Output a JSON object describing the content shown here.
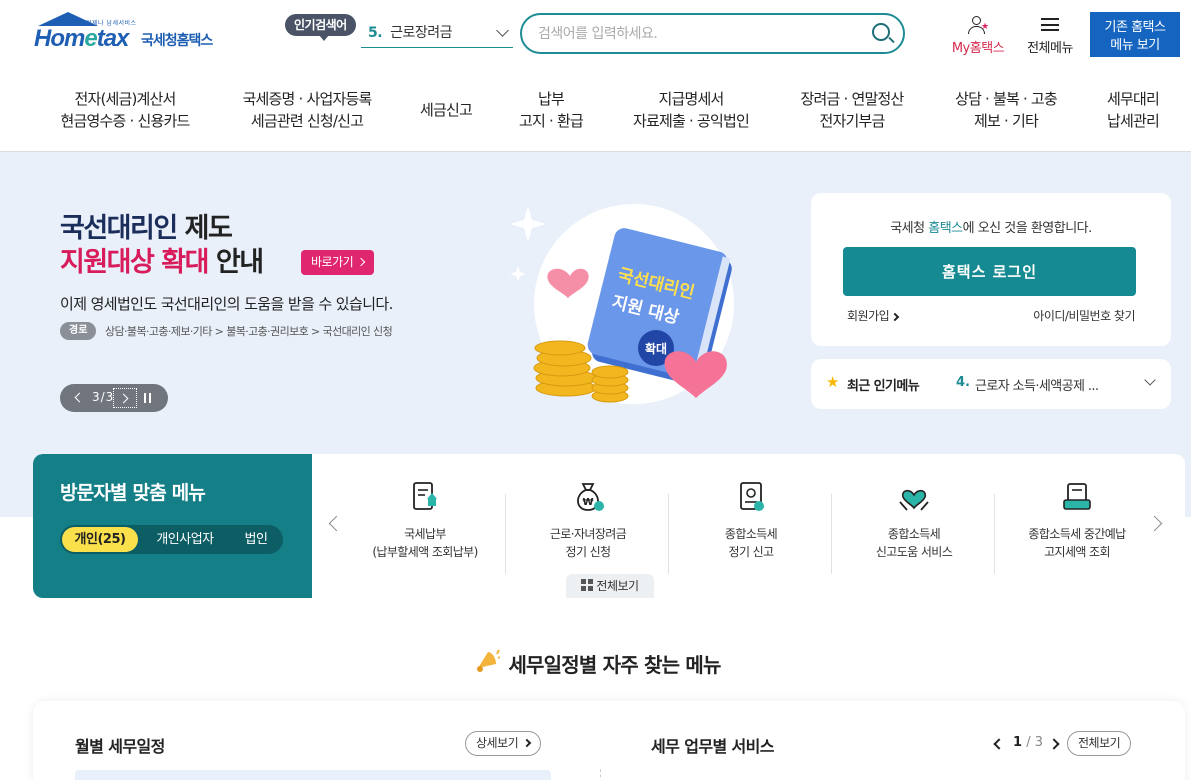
{
  "header": {
    "logo": {
      "tiny": "언제나 납세서비스",
      "word_a": "Hom",
      "word_e": "e",
      "word_b": "tax",
      "name": "국세청홈택스"
    },
    "popular": {
      "badge": "인기검색어",
      "num": "5.",
      "term": "근로장려금"
    },
    "search": {
      "placeholder": "검색어를 입력하세요."
    },
    "my_label": "My홈택스",
    "all_menu_label": "전체메뉴",
    "old_menu": {
      "line1": "기존 홈택스",
      "line2": "메뉴 보기"
    }
  },
  "gnb": [
    {
      "l1": "전자(세금)계산서",
      "l2": "현금영수증 · 신용카드"
    },
    {
      "l1": "국세증명 · 사업자등록",
      "l2": "세금관련 신청/신고"
    },
    {
      "l1": "세금신고",
      "l2": ""
    },
    {
      "l1": "납부",
      "l2": "고지 · 환급"
    },
    {
      "l1": "지급명세서",
      "l2": "자료제출 · 공익법인"
    },
    {
      "l1": "장려금 · 연말정산",
      "l2": "전자기부금"
    },
    {
      "l1": "상담 · 불복 · 고충",
      "l2": "제보 · 기타"
    },
    {
      "l1": "세무대리",
      "l2": "납세관리"
    }
  ],
  "hero": {
    "title_a": "국선대리인",
    "title_b": " 제도",
    "title_c": "지원대상 확대",
    "title_d": " 안내",
    "go_label": "바로가기",
    "desc": "이제 영세법인도 국선대리인의 도움을 받을 수 있습니다.",
    "path_badge": "경로",
    "path": "상담·불복·고충·제보·기타 > 불복·고충·권리보호 > 국선대리인 신청",
    "slide_page": "3/3",
    "book_line1": "국선대리인",
    "book_line2": "지원 대상",
    "book_badge": "확대"
  },
  "login": {
    "welcome_a": "국세청 ",
    "welcome_b": "홈택스",
    "welcome_c": "에 오신 것을 환영합니다.",
    "login_label": "홈택스 로그인",
    "join_label": "회원가입",
    "find_label": "아이디/비밀번호 찾기"
  },
  "recent": {
    "title": "최근 인기메뉴",
    "num": "4.",
    "value": "근로자 소득·세액공제 ..."
  },
  "visitor": {
    "title": "방문자별 맞춤 메뉴",
    "tabs": [
      "개인(25)",
      "개인사업자",
      "법인"
    ],
    "items": [
      {
        "icon": "tax-payment-icon",
        "l1": "국세납부",
        "l2": "(납부할세액 조회납부)"
      },
      {
        "icon": "money-bag-icon",
        "l1": "근로·자녀장려금",
        "l2": "정기 신청"
      },
      {
        "icon": "document-report-icon",
        "l1": "종합소득세",
        "l2": "정기 신고"
      },
      {
        "icon": "heart-hands-icon",
        "l1": "종합소득세",
        "l2": "신고도움 서비스"
      },
      {
        "icon": "invoice-stack-icon",
        "l1": "종합소득세 중간예납",
        "l2": "고지세액 조회"
      }
    ],
    "all_view": "전체보기"
  },
  "schedule": {
    "title": "세무일정별 자주 찾는 메뉴",
    "month_title": "월별 세무일정",
    "detail_label": "상세보기",
    "service_title": "세무 업무별 서비스",
    "page_current": "1",
    "page_total": "/ 3",
    "all_label": "전체보기"
  },
  "colors": {
    "teal": "#147f87",
    "brand_blue": "#1565c0",
    "pink": "#e0266e",
    "hero_bg": "#e9f0fa",
    "yellow": "#fae04a"
  }
}
